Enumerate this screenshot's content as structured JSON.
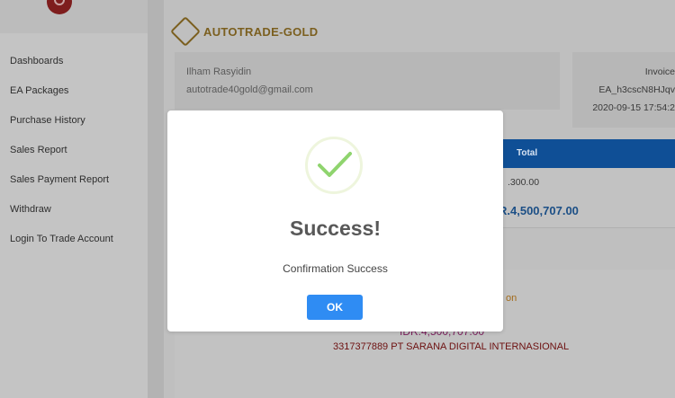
{
  "sidebar": {
    "items": [
      {
        "label": "Dashboards"
      },
      {
        "label": "EA Packages"
      },
      {
        "label": "Purchase History"
      },
      {
        "label": "Sales Report"
      },
      {
        "label": "Sales Payment Report"
      },
      {
        "label": "Withdraw"
      },
      {
        "label": "Login To Trade Account"
      }
    ]
  },
  "brand": {
    "name": "AUTOTRADE-GOLD",
    "color": "#7b5f1f"
  },
  "customer": {
    "name": "Ilham Rasyidin",
    "email": "autotrade40gold@gmail.com"
  },
  "invoice": {
    "label": "Invoice",
    "id": "EA_h3cscN8HJqv",
    "datetime": "2020-09-15 17:54:2"
  },
  "table": {
    "header_total": "Total",
    "row_amount": ".300.00",
    "grand_total": "R.4,500,707.00"
  },
  "payment": {
    "partial_label": "on",
    "amount": "IDR.4,500,707.00",
    "account": "3317377889 PT SARANA DIGITAL INTERNASIONAL"
  },
  "modal": {
    "title": "Success!",
    "message": "Confirmation Success",
    "ok_label": "OK",
    "check_icon": "check-icon",
    "accent": "#2f8cf3",
    "check_color": "#8fd46e"
  }
}
